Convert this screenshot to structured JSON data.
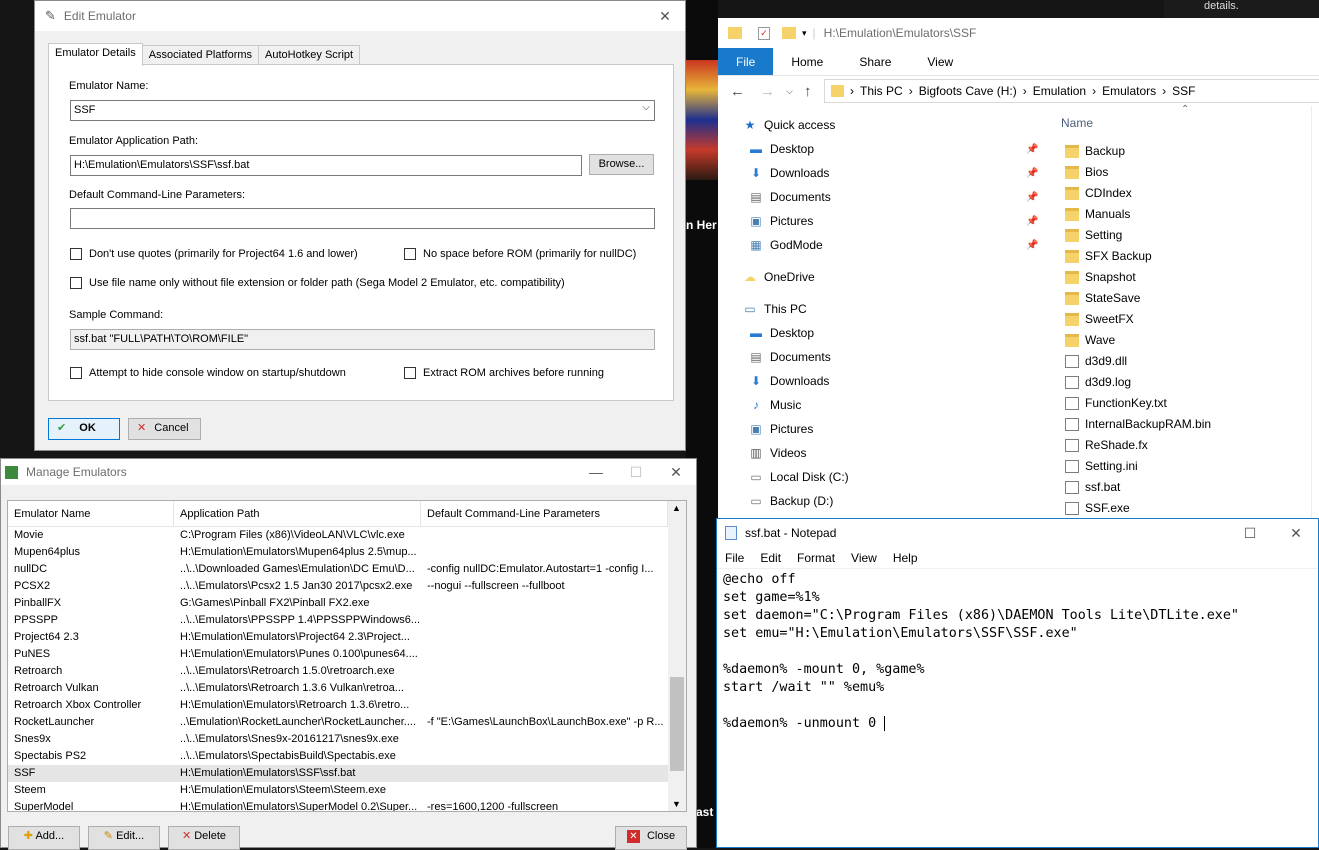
{
  "background": {
    "hero_text": "n Her",
    "ast_text": "ast",
    "topright_text": "details."
  },
  "edit_emulator": {
    "title": "Edit Emulator",
    "close": "✕",
    "tabs": [
      {
        "label": "Emulator Details"
      },
      {
        "label": "Associated Platforms"
      },
      {
        "label": "AutoHotkey Script"
      }
    ],
    "emulator_name_label": "Emulator Name:",
    "emulator_name_value": "SSF",
    "app_path_label": "Emulator Application Path:",
    "app_path_value": "H:\\Emulation\\Emulators\\SSF\\ssf.bat",
    "browse_label": "Browse...",
    "cmdline_label": "Default Command-Line Parameters:",
    "cmdline_value": "",
    "opt_no_quotes": "Don't use quotes (primarily for Project64 1.6 and lower)",
    "opt_no_space": "No space before ROM (primarily for nullDC)",
    "opt_filename_only": "Use file name only without file extension or folder path (Sega Model 2 Emulator, etc. compatibility)",
    "sample_label": "Sample Command:",
    "sample_value": "ssf.bat \"FULL\\PATH\\TO\\ROM\\FILE\"",
    "opt_hide_console": "Attempt to hide console window on startup/shutdown",
    "opt_extract": "Extract ROM archives before running",
    "ok_label": "OK",
    "cancel_label": "Cancel"
  },
  "manage_emulators": {
    "title": "Manage Emulators",
    "columns": [
      "Emulator Name",
      "Application Path",
      "Default Command-Line Parameters"
    ],
    "rows": [
      {
        "name": "Movie",
        "path": "C:\\Program Files (x86)\\VideoLAN\\VLC\\vlc.exe",
        "params": ""
      },
      {
        "name": "Mupen64plus",
        "path": "H:\\Emulation\\Emulators\\Mupen64plus 2.5\\mup...",
        "params": ""
      },
      {
        "name": "nullDC",
        "path": "..\\..\\Downloaded Games\\Emulation\\DC Emu\\D...",
        "params": "-config nullDC:Emulator.Autostart=1 -config I..."
      },
      {
        "name": "PCSX2",
        "path": "..\\..\\Emulators\\Pcsx2 1.5 Jan30 2017\\pcsx2.exe",
        "params": "--nogui --fullscreen --fullboot"
      },
      {
        "name": "PinballFX",
        "path": "G:\\Games\\Pinball FX2\\Pinball FX2.exe",
        "params": ""
      },
      {
        "name": "PPSSPP",
        "path": "..\\..\\Emulators\\PPSSPP 1.4\\PPSSPPWindows6...",
        "params": ""
      },
      {
        "name": "Project64 2.3",
        "path": "H:\\Emulation\\Emulators\\Project64 2.3\\Project...",
        "params": ""
      },
      {
        "name": "PuNES",
        "path": "H:\\Emulation\\Emulators\\Punes 0.100\\punes64....",
        "params": ""
      },
      {
        "name": "Retroarch",
        "path": "..\\..\\Emulators\\Retroarch 1.5.0\\retroarch.exe",
        "params": ""
      },
      {
        "name": "Retroarch Vulkan",
        "path": "..\\..\\Emulators\\Retroarch 1.3.6 Vulkan\\retroa...",
        "params": ""
      },
      {
        "name": "Retroarch Xbox Controller",
        "path": "H:\\Emulation\\Emulators\\Retroarch 1.3.6\\retro...",
        "params": ""
      },
      {
        "name": "RocketLauncher",
        "path": "..\\Emulation\\RocketLauncher\\RocketLauncher....",
        "params": "-f \"E:\\Games\\LaunchBox\\LaunchBox.exe\" -p R..."
      },
      {
        "name": "Snes9x",
        "path": "..\\..\\Emulators\\Snes9x-20161217\\snes9x.exe",
        "params": ""
      },
      {
        "name": "Spectabis PS2",
        "path": "..\\..\\Emulators\\SpectabisBuild\\Spectabis.exe",
        "params": ""
      },
      {
        "name": "SSF",
        "path": "H:\\Emulation\\Emulators\\SSF\\ssf.bat",
        "params": ""
      },
      {
        "name": "Steem",
        "path": "H:\\Emulation\\Emulators\\Steem\\Steem.exe",
        "params": ""
      },
      {
        "name": "SuperModel",
        "path": "H:\\Emulation\\Emulators\\SuperModel 0.2\\Super...",
        "params": "-res=1600,1200 -fullscreen"
      }
    ],
    "add_label": "Add...",
    "edit_label": "Edit...",
    "delete_label": "Delete",
    "close_label": "Close"
  },
  "explorer": {
    "title": "H:\\Emulation\\Emulators\\SSF",
    "ribbon": [
      "File",
      "Home",
      "Share",
      "View"
    ],
    "breadcrumbs": [
      "This PC",
      "Bigfoots Cave (H:)",
      "Emulation",
      "Emulators",
      "SSF"
    ],
    "nav": [
      {
        "label": "Quick access",
        "icon": "star-icon"
      },
      {
        "label": "Desktop",
        "icon": "desktop-icon",
        "pinned": true
      },
      {
        "label": "Downloads",
        "icon": "download-icon",
        "pinned": true
      },
      {
        "label": "Documents",
        "icon": "documents-icon",
        "pinned": true
      },
      {
        "label": "Pictures",
        "icon": "pictures-icon",
        "pinned": true
      },
      {
        "label": "GodMode",
        "icon": "godmode-icon",
        "pinned": true
      },
      {
        "label": "OneDrive",
        "icon": "cloud-icon"
      },
      {
        "label": "This PC",
        "icon": "computer-icon"
      },
      {
        "label": "Desktop",
        "icon": "desktop-icon"
      },
      {
        "label": "Documents",
        "icon": "documents-icon"
      },
      {
        "label": "Downloads",
        "icon": "download-icon"
      },
      {
        "label": "Music",
        "icon": "music-icon"
      },
      {
        "label": "Pictures",
        "icon": "pictures-icon"
      },
      {
        "label": "Videos",
        "icon": "videos-icon"
      },
      {
        "label": "Local Disk (C:)",
        "icon": "drive-icon"
      },
      {
        "label": "Backup (D:)",
        "icon": "drive-icon"
      }
    ],
    "column_name": "Name",
    "files": [
      {
        "label": "Backup",
        "type": "folder"
      },
      {
        "label": "Bios",
        "type": "folder"
      },
      {
        "label": "CDIndex",
        "type": "folder"
      },
      {
        "label": "Manuals",
        "type": "folder"
      },
      {
        "label": "Setting",
        "type": "folder"
      },
      {
        "label": "SFX Backup",
        "type": "folder"
      },
      {
        "label": "Snapshot",
        "type": "folder"
      },
      {
        "label": "StateSave",
        "type": "folder"
      },
      {
        "label": "SweetFX",
        "type": "folder"
      },
      {
        "label": "Wave",
        "type": "folder"
      },
      {
        "label": "d3d9.dll",
        "type": "file"
      },
      {
        "label": "d3d9.log",
        "type": "file"
      },
      {
        "label": "FunctionKey.txt",
        "type": "file"
      },
      {
        "label": "InternalBackupRAM.bin",
        "type": "file"
      },
      {
        "label": "ReShade.fx",
        "type": "file"
      },
      {
        "label": "Setting.ini",
        "type": "file"
      },
      {
        "label": "ssf.bat",
        "type": "file"
      },
      {
        "label": "SSF.exe",
        "type": "file"
      }
    ]
  },
  "notepad": {
    "title": "ssf.bat - Notepad",
    "menu": [
      "File",
      "Edit",
      "Format",
      "View",
      "Help"
    ],
    "lines": [
      "@echo off",
      "set game=%1%",
      "set daemon=\"C:\\Program Files (x86)\\DAEMON Tools Lite\\DTLite.exe\"",
      "set emu=\"H:\\Emulation\\Emulators\\SSF\\SSF.exe\"",
      "",
      "%daemon% -mount 0, %game%",
      "start /wait \"\" %emu%",
      "",
      "%daemon% -unmount 0 "
    ]
  },
  "colors": {
    "accent": "#1979ca",
    "folder": "#f5d26a",
    "selection": "#e5e5e5",
    "ok_green": "#2fa13a",
    "cancel_red": "#d22b2b"
  }
}
